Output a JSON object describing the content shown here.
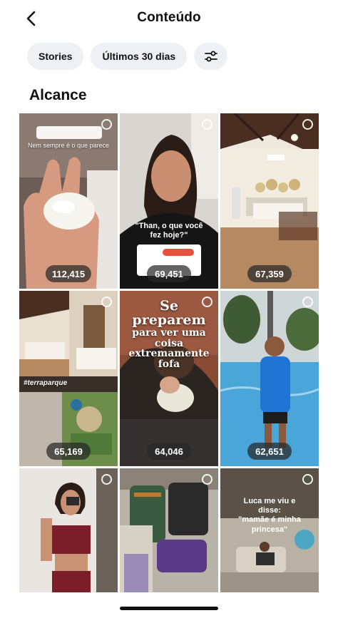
{
  "header": {
    "title": "Conteúdo",
    "back_icon": "chevron-left-icon"
  },
  "filters": {
    "chips": [
      {
        "label": "Stories"
      },
      {
        "label": "Últimos 30 dias"
      }
    ],
    "settings_icon": "sliders-icon"
  },
  "section": {
    "title": "Alcance"
  },
  "tiles": [
    {
      "count": "112,415",
      "overlay": "Nem sempre é o que parece"
    },
    {
      "count": "69,451",
      "overlay": "\"Than, o que você fez hoje?\""
    },
    {
      "count": "67,359"
    },
    {
      "count": "65,169",
      "overlay": "#terraparque"
    },
    {
      "count": "64,046",
      "overlay": {
        "line1": "Se preparem",
        "line2": "para ver uma coisa",
        "line3": "extremamente fofa"
      }
    },
    {
      "count": "62,651"
    },
    {
      "count": ""
    },
    {
      "count": ""
    },
    {
      "count": "",
      "overlay": {
        "line1": "Luca me viu e disse:",
        "line2": "\"mamãe é minha princesa\""
      }
    }
  ],
  "colors": {
    "chip_bg": "#eef0f3",
    "badge_bg": "#282828"
  }
}
